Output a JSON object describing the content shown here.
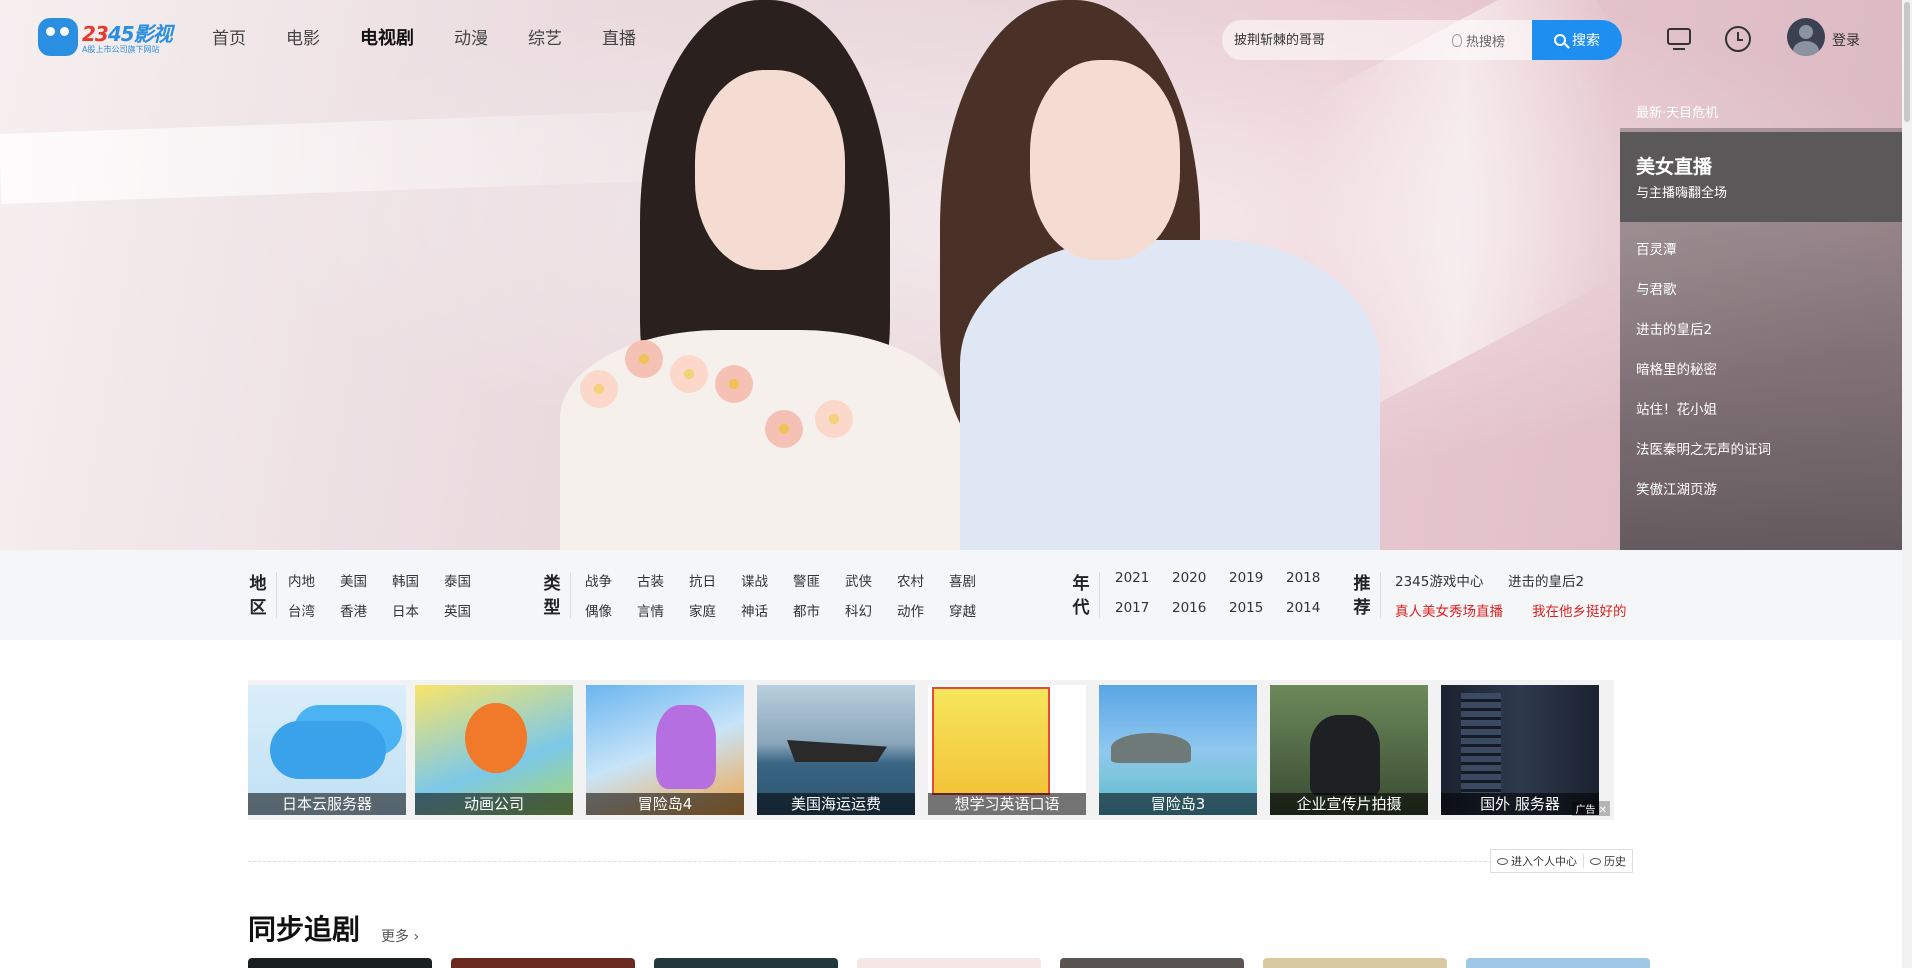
{
  "brand": {
    "logo_text_a": "23",
    "logo_text_b": "45影视",
    "logo_sub": "A股上市公司旗下网站"
  },
  "nav": [
    {
      "label": "首页",
      "active": false
    },
    {
      "label": "电影",
      "active": false
    },
    {
      "label": "电视剧",
      "active": true
    },
    {
      "label": "动漫",
      "active": false
    },
    {
      "label": "综艺",
      "active": false
    },
    {
      "label": "直播",
      "active": false
    }
  ],
  "search": {
    "placeholder": "披荆斩棘的哥哥",
    "hot_label": "热搜榜",
    "button_label": "搜索"
  },
  "user": {
    "login_label": "登录",
    "icons": [
      "tv-icon",
      "clock-icon",
      "avatar"
    ]
  },
  "side": {
    "first": "最新·天目危机",
    "active": {
      "title": "美女直播",
      "subtitle": "与主播嗨翻全场"
    },
    "items": [
      "百灵潭",
      "与君歌",
      "进击的皇后2",
      "暗格里的秘密",
      "站住！花小姐",
      "法医秦明之无声的证词",
      "笑傲江湖页游"
    ]
  },
  "filters": {
    "region": {
      "title": "地区",
      "row1": [
        "内地",
        "美国",
        "韩国",
        "泰国"
      ],
      "row2": [
        "台湾",
        "香港",
        "日本",
        "英国"
      ]
    },
    "type": {
      "title": "类型",
      "row1": [
        "战争",
        "古装",
        "抗日",
        "谍战",
        "警匪",
        "武侠",
        "农村",
        "喜剧"
      ],
      "row2": [
        "偶像",
        "言情",
        "家庭",
        "神话",
        "都市",
        "科幻",
        "动作",
        "穿越"
      ]
    },
    "year": {
      "title": "年代",
      "row1": [
        "2021",
        "2020",
        "2019",
        "2018"
      ],
      "row2": [
        "2017",
        "2016",
        "2015",
        "2014"
      ]
    },
    "recommend": {
      "title": "推荐",
      "row1": [
        "2345游戏中心",
        "进击的皇后2"
      ],
      "row2": [
        "真人美女秀场直播",
        "我在他乡挺好的"
      ]
    }
  },
  "ads": {
    "items": [
      {
        "caption": "日本云服务器",
        "image": "cloud-icon"
      },
      {
        "caption": "动画公司",
        "image": "cartoon-image"
      },
      {
        "caption": "冒险岛4",
        "image": "game-image"
      },
      {
        "caption": "美国海运运费",
        "image": "ship-image"
      },
      {
        "caption": "想学习英语口语",
        "image": "book-image"
      },
      {
        "caption": "冒险岛3",
        "image": "island-image"
      },
      {
        "caption": "企业宣传片拍摄",
        "image": "camera-crew-image"
      },
      {
        "caption": "国外 服务器",
        "image": "server-rack-image"
      }
    ],
    "ad_mark": "广告"
  },
  "user_center": {
    "center_label": "进入个人中心",
    "history_label": "历史"
  },
  "section": {
    "title": "同步追剧",
    "more_label": "更多"
  },
  "colors": {
    "accent": "#1e8ef0",
    "highlight": "#e02020"
  }
}
